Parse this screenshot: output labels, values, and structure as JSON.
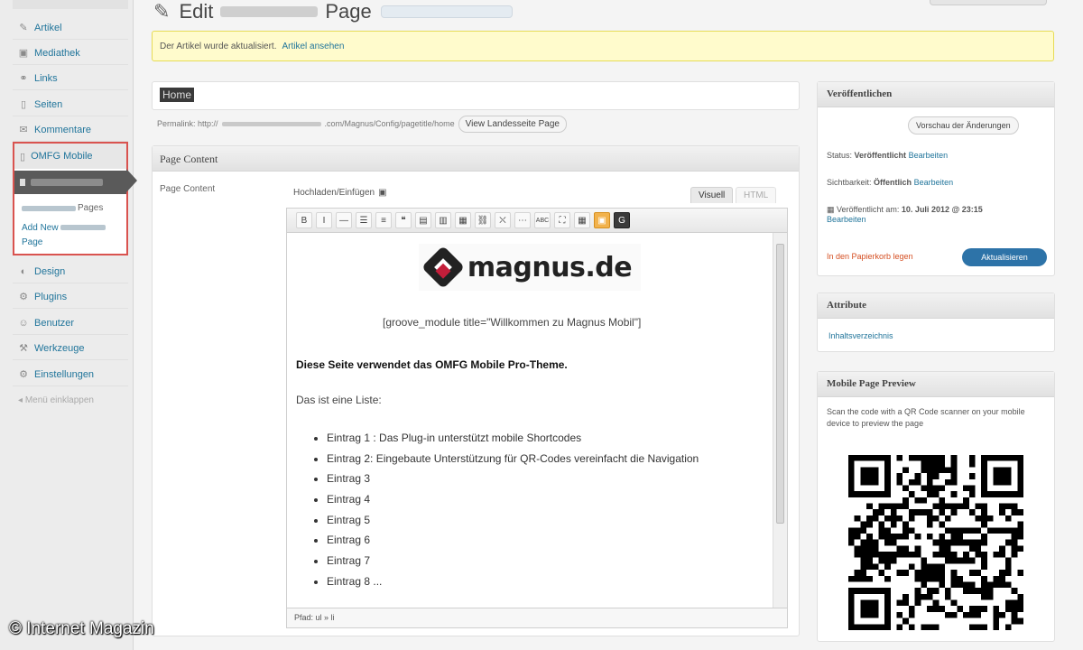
{
  "page_title": {
    "prefix": "Edit",
    "suffix": "Page"
  },
  "sidebar": {
    "items": [
      {
        "id": "articles",
        "icon": "pencil-icon",
        "label": "Artikel"
      },
      {
        "id": "media",
        "icon": "media-icon",
        "label": "Mediathek"
      },
      {
        "id": "links",
        "icon": "link-icon",
        "label": "Links"
      },
      {
        "id": "pages",
        "icon": "page-icon",
        "label": "Seiten"
      },
      {
        "id": "comments",
        "icon": "comment-icon",
        "label": "Kommentare"
      }
    ],
    "omfg": {
      "label": "OMFG Mobile",
      "sub_suffix": "Pages",
      "add_new_prefix": "Add New",
      "add_new_suffix": "Page"
    },
    "items_lower": [
      {
        "id": "design",
        "icon": "design-icon",
        "label": "Design"
      },
      {
        "id": "plugins",
        "icon": "plugin-icon",
        "label": "Plugins"
      },
      {
        "id": "users",
        "icon": "users-icon",
        "label": "Benutzer"
      },
      {
        "id": "tools",
        "icon": "tools-icon",
        "label": "Werkzeuge"
      },
      {
        "id": "settings",
        "icon": "settings-icon",
        "label": "Einstellungen"
      }
    ],
    "collapse": "Menü einklappen"
  },
  "notice": {
    "text": "Der Artikel wurde aktualisiert.",
    "link": "Artikel ansehen"
  },
  "title_input": {
    "value": "Home"
  },
  "permalink": {
    "label": "Permalink: http://",
    "path": ".com/Magnus/Config/pagetitle/home",
    "button": "View Landesseite Page"
  },
  "content_box": {
    "header": "Page Content",
    "label": "Page Content",
    "upload": "Hochladen/Einfügen",
    "tab_visual": "Visuell",
    "tab_html": "HTML"
  },
  "toolbar": {
    "buttons": [
      {
        "name": "bold-button",
        "glyph": "B"
      },
      {
        "name": "italic-button",
        "glyph": "I"
      },
      {
        "name": "strikethrough-button",
        "glyph": "—"
      },
      {
        "name": "bullet-list-button",
        "glyph": "☰"
      },
      {
        "name": "numbered-list-button",
        "glyph": "≡"
      },
      {
        "name": "blockquote-button",
        "glyph": "❝"
      },
      {
        "name": "align-left-button",
        "glyph": "▤"
      },
      {
        "name": "align-center-button",
        "glyph": "▥"
      },
      {
        "name": "align-right-button",
        "glyph": "▦"
      },
      {
        "name": "link-button",
        "glyph": "⛓"
      },
      {
        "name": "unlink-button",
        "glyph": "⛌"
      },
      {
        "name": "more-button",
        "glyph": "⋯"
      },
      {
        "name": "spellcheck-button",
        "glyph": "ABC"
      },
      {
        "name": "fullscreen-button",
        "glyph": "⛶"
      },
      {
        "name": "kitchen-sink-button",
        "glyph": "▦"
      },
      {
        "name": "qr-insert-button",
        "glyph": "▣",
        "accent": "orange"
      },
      {
        "name": "gravity-button",
        "glyph": "G",
        "accent": "dark"
      }
    ]
  },
  "editor": {
    "logo_text": "magnus.de",
    "shortcode": "[groove_module title=\"Willkommen zu Magnus Mobil\"]",
    "bold_line": "Diese Seite verwendet das OMFG Mobile Pro-Theme.",
    "list_intro": "Das ist eine Liste:",
    "entries": [
      "Eintrag 1 : Das Plug-in unterstützt mobile Shortcodes",
      "Eintrag 2: Eingebaute Unterstützung für QR-Codes vereinfacht die Navigation",
      "Eintrag 3",
      "Eintrag 4",
      "Eintrag 5",
      "Eintrag 6",
      "Eintrag 7",
      "Eintrag 8 ..."
    ],
    "status": "Pfad: ul » li"
  },
  "publish": {
    "header": "Veröffentlichen",
    "preview_button": "Vorschau der Änderungen",
    "status_label": "Status:",
    "status_value": "Veröffentlicht",
    "status_link": "Bearbeiten",
    "visibility_label": "Sichtbarkeit:",
    "visibility_value": "Öffentlich",
    "visibility_link": "Bearbeiten",
    "published_label": "Veröffentlicht am:",
    "published_value": "10. Juli 2012 @ 23:15",
    "published_link": "Bearbeiten",
    "trash": "In den Papierkorb legen",
    "update_button": "Aktualisieren"
  },
  "attributes": {
    "header": "Attribute",
    "link": "Inhaltsverzeichnis"
  },
  "mobile_preview": {
    "header": "Mobile Page Preview",
    "text": "Scan the code with a QR Code scanner on your mobile device to preview the page"
  },
  "watermark": "© Internet Magazin",
  "colors": {
    "link": "#21759b",
    "notice_bg": "#fffbcc",
    "update_btn": "#2d73a8",
    "highlight_border": "#d9534f",
    "trash": "#d54e21"
  }
}
